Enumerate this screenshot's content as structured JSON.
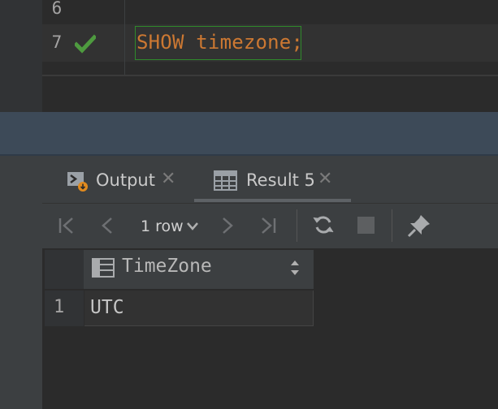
{
  "editor": {
    "line_numbers": [
      "6",
      "7"
    ],
    "code": {
      "keyword": "SHOW",
      "identifier": "timezone",
      "terminator": ";"
    },
    "status_icon": "check-icon",
    "status_color": "#4e9a3f"
  },
  "results": {
    "tabs": [
      {
        "label": "Output",
        "icon": "console-output-icon",
        "close": "✕"
      },
      {
        "label": "Result 5",
        "icon": "table-icon",
        "close": "✕",
        "active": true
      }
    ],
    "toolbar": {
      "rows_label": "1 row",
      "icons": [
        "first-page-icon",
        "previous-page-icon",
        "next-page-icon",
        "last-page-icon",
        "refresh-icon",
        "stop-icon",
        "pin-icon"
      ]
    },
    "grid": {
      "columns": [
        "TimeZone"
      ],
      "rows": [
        {
          "num": "1",
          "cells": [
            "UTC"
          ]
        }
      ]
    }
  },
  "colors": {
    "keyword": "#cc7832",
    "accent_green": "#4e9a3f",
    "selection_border": "#2f8a2b",
    "splitter": "#3d4a58"
  }
}
